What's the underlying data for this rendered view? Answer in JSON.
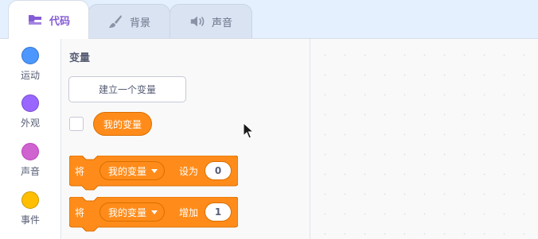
{
  "tabs": [
    {
      "label": "代码",
      "icon": "code-icon",
      "active": true
    },
    {
      "label": "背景",
      "icon": "paintbrush-icon",
      "active": false
    },
    {
      "label": "声音",
      "icon": "speaker-icon",
      "active": false
    }
  ],
  "categories": [
    {
      "label": "运动",
      "color": "#4c97ff",
      "border": "#3373cc"
    },
    {
      "label": "外观",
      "color": "#9966ff",
      "border": "#774dcb"
    },
    {
      "label": "声音",
      "color": "#cf63cf",
      "border": "#bd42bd"
    },
    {
      "label": "事件",
      "color": "#ffbf00",
      "border": "#cc9900"
    }
  ],
  "flyout": {
    "section_title": "变量",
    "make_variable_label": "建立一个变量",
    "variable_reporter": "我的变量",
    "variable_checked": false,
    "blocks": [
      {
        "prefix": "将",
        "variable": "我的变量",
        "action": "设为",
        "value": "0"
      },
      {
        "prefix": "将",
        "variable": "我的变量",
        "action": "增加",
        "value": "1"
      }
    ]
  },
  "colors": {
    "variables_block": "#ff8c1a",
    "variables_border": "#db6e00",
    "active_tab_text": "#855cd6",
    "background": "#e5f0ff"
  }
}
